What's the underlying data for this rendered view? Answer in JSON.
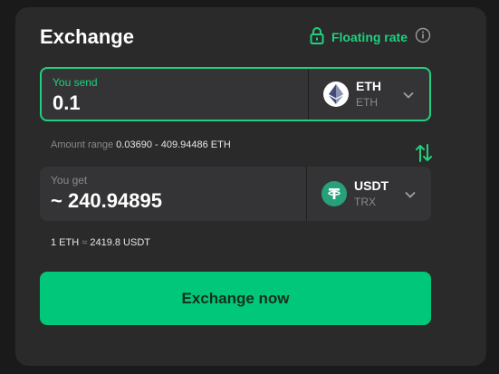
{
  "header": {
    "title": "Exchange",
    "rate_label": "Floating rate"
  },
  "send": {
    "label": "You send",
    "amount": "0.1",
    "currency_code": "ETH",
    "network": "ETH",
    "range_label": "Amount range",
    "range_value": "0.03690 - 409.94486 ETH"
  },
  "get": {
    "label": "You get",
    "amount": "~ 240.94895",
    "currency_code": "USDT",
    "network": "TRX"
  },
  "rate": {
    "left": "1 ETH",
    "sep": "≈",
    "right": "2419.8 USDT"
  },
  "cta": {
    "label": "Exchange now"
  },
  "icons": {
    "lock": "lock-icon",
    "info": "info-icon",
    "swap": "swap-icon",
    "eth": "ethereum-icon",
    "usdt": "tether-icon",
    "chevron": "chevron-down-icon"
  },
  "colors": {
    "accent": "#1fd07f",
    "button": "#00c77a",
    "card": "#2a2a2b",
    "field": "#343436"
  }
}
